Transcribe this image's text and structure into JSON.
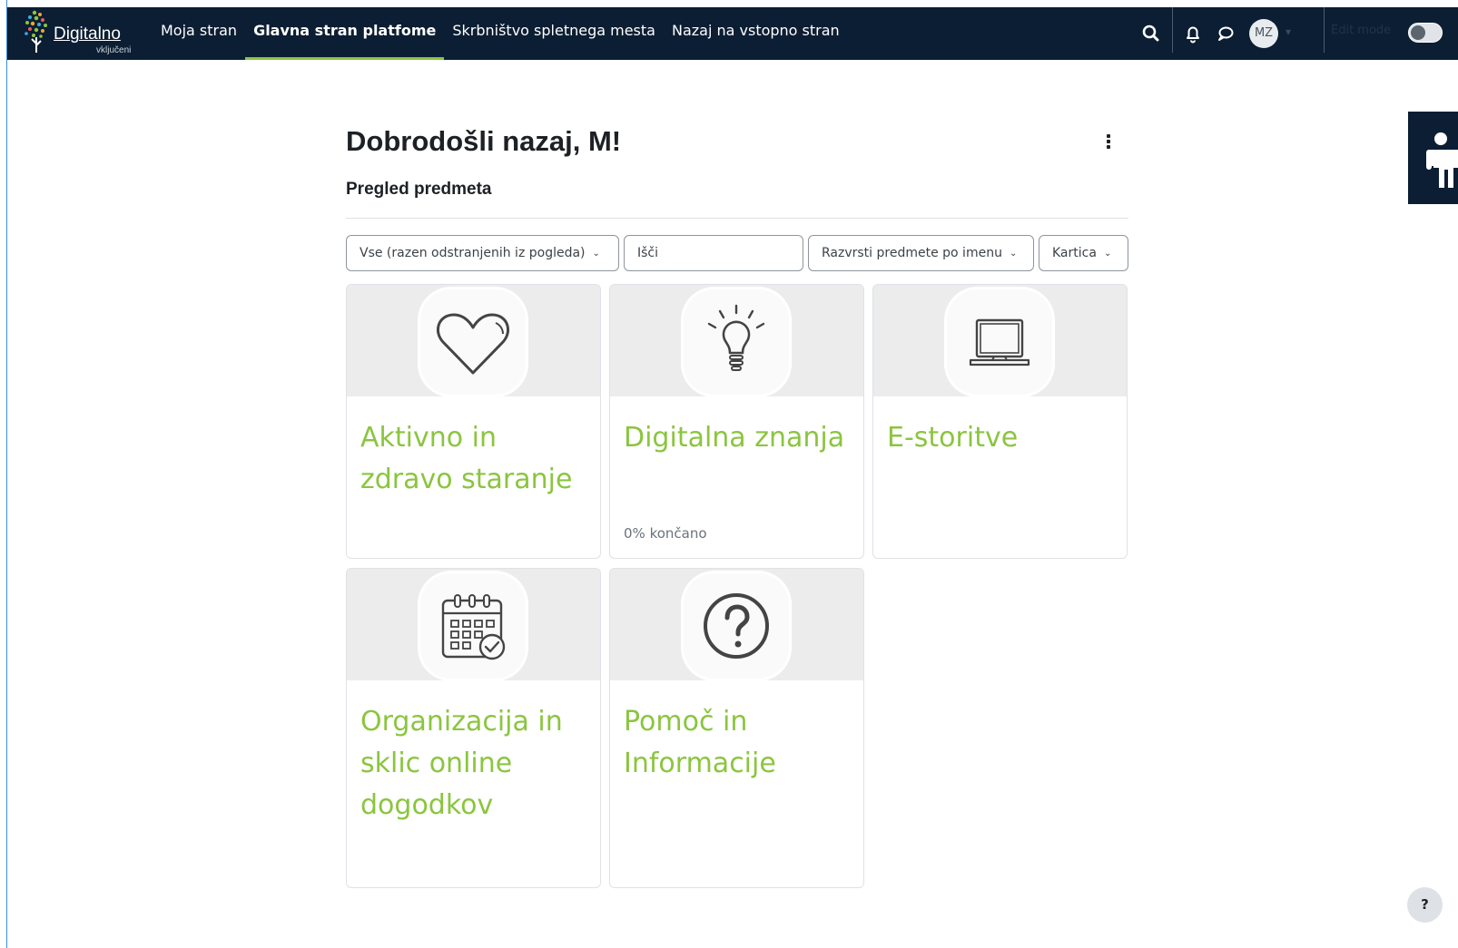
{
  "brand": {
    "name": "Digitalno",
    "tagline": "vključeni"
  },
  "nav": {
    "items": [
      {
        "label": "Moja stran",
        "active": false
      },
      {
        "label": "Glavna stran platfome",
        "active": true
      },
      {
        "label": "Skrbništvo spletnega mesta",
        "active": false
      },
      {
        "label": "Nazaj na vstopno stran",
        "active": false
      }
    ]
  },
  "user": {
    "initials": "MZ"
  },
  "edit_mode": {
    "label": "Edit mode",
    "on": false
  },
  "page": {
    "title": "Dobrodošli nazaj, M!",
    "block_title": "Pregled predmeta"
  },
  "filters": {
    "grouping": "Vse (razen odstranjenih iz pogleda)",
    "search_placeholder": "Išči",
    "sort": "Razvrsti predmete po imenu",
    "view": "Kartica"
  },
  "courses": [
    {
      "title": "Aktivno in zdravo staranje",
      "icon": "heart-icon",
      "progress": ""
    },
    {
      "title": "Digitalna znanja",
      "icon": "lightbulb-icon",
      "progress": "0% končano"
    },
    {
      "title": "E-storitve",
      "icon": "laptop-icon",
      "progress": ""
    },
    {
      "title": "Organizacija in sklic online dogodkov",
      "icon": "calendar-icon",
      "progress": ""
    },
    {
      "title": "Pomoč in Informacije",
      "icon": "question-icon",
      "progress": ""
    }
  ],
  "help": {
    "label": "?"
  },
  "colors": {
    "topbar": "#0c1e33",
    "accent": "#8bc53f",
    "card_header": "#ececec"
  }
}
